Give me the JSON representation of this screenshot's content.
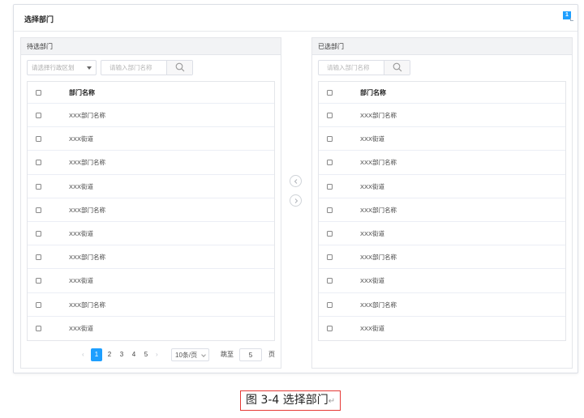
{
  "dialog": {
    "title": "选择部门",
    "corner_badge": "1"
  },
  "left_panel": {
    "title": "待选部门",
    "region_select": {
      "value": "请选择行政区划"
    },
    "search": {
      "placeholder": "请输入部门名称"
    },
    "table": {
      "header": "部门名称",
      "rows": [
        "XXX部门名称",
        "XXX街道",
        "XXX部门名称",
        "XXX街道",
        "XXX部门名称",
        "XXX街道",
        "XXX部门名称",
        "XXX街道",
        "XXX部门名称",
        "XXX街道"
      ]
    },
    "pagination": {
      "prev": "‹",
      "pages": [
        "1",
        "2",
        "3",
        "4",
        "5"
      ],
      "active_page": "1",
      "next": "›",
      "page_size": "10条/页",
      "goto_label": "跳至",
      "goto_value": "5",
      "page_unit": "页"
    }
  },
  "right_panel": {
    "title": "已选部门",
    "search": {
      "placeholder": "请输入部门名称"
    },
    "table": {
      "header": "部门名称",
      "rows": [
        "XXX部门名称",
        "XXX街道",
        "XXX部门名称",
        "XXX街道",
        "XXX部门名称",
        "XXX街道",
        "XXX部门名称",
        "XXX街道",
        "XXX部门名称",
        "XXX街道"
      ]
    }
  },
  "transfer_buttons": {
    "to_left_icon": "chevron-left-icon",
    "to_right_icon": "chevron-right-icon"
  },
  "caption": {
    "text": "图 3-4 选择部门",
    "mark": "↵"
  }
}
